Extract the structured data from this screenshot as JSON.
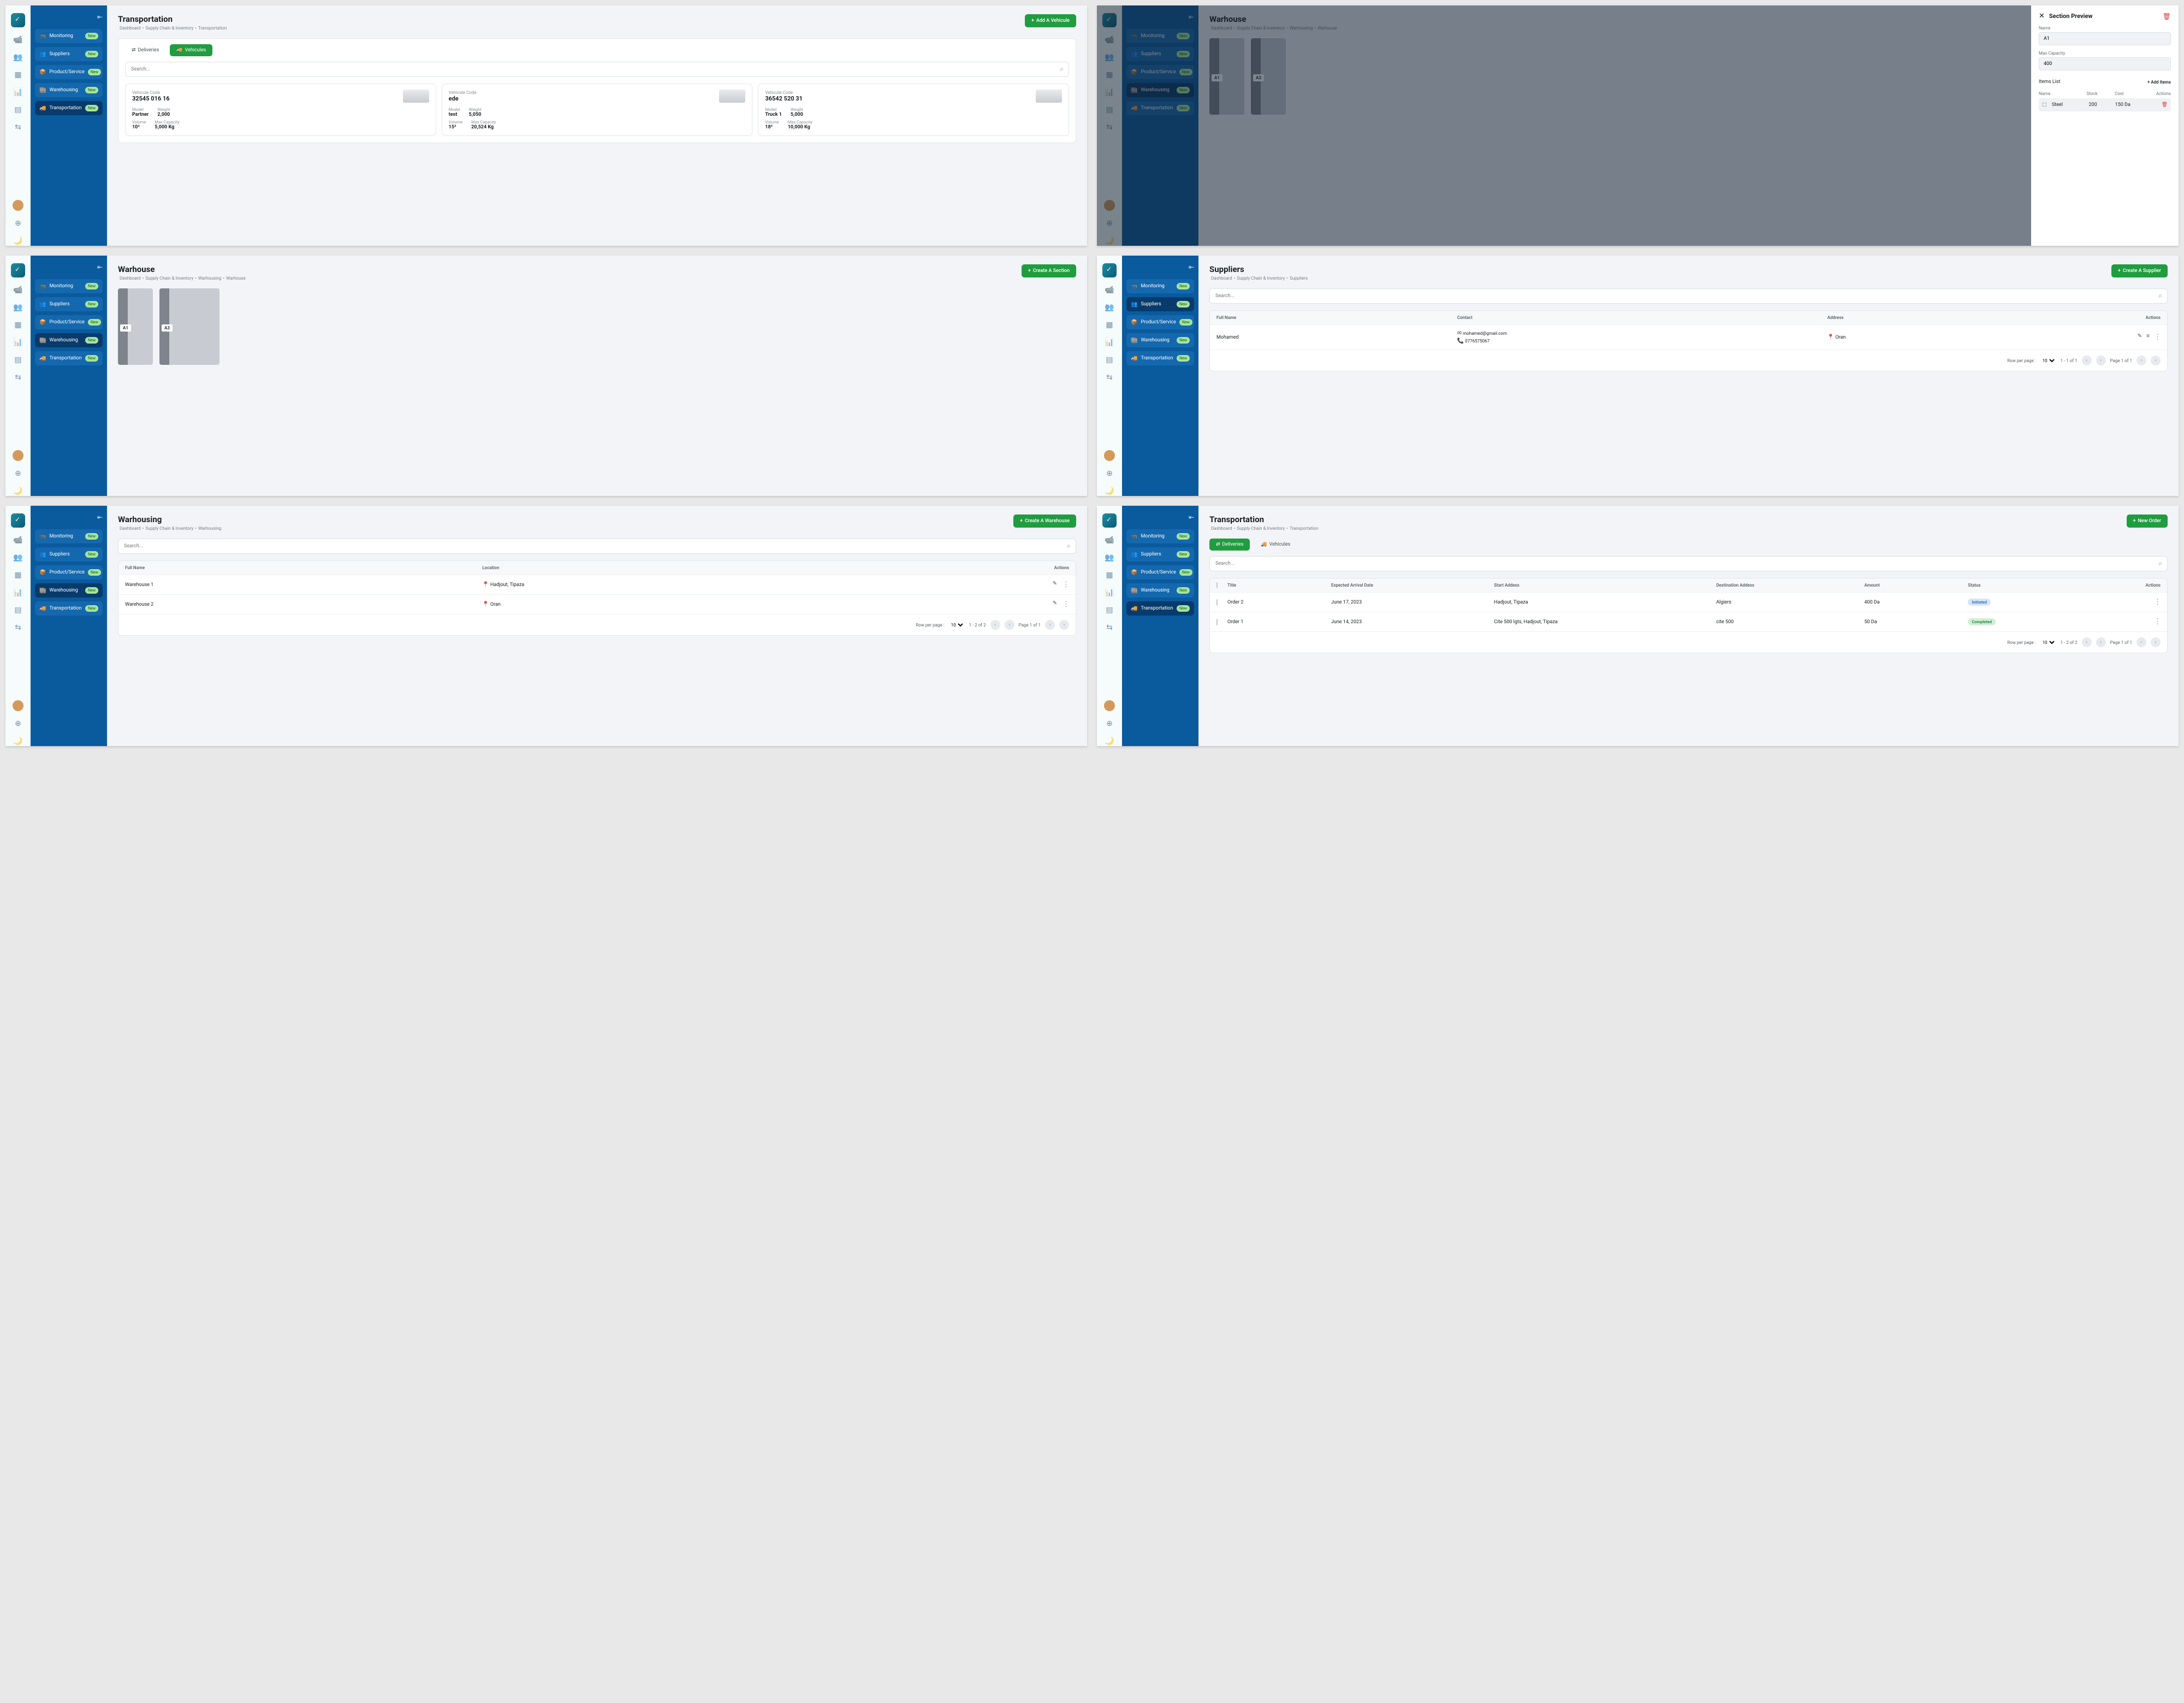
{
  "nav": {
    "items": [
      {
        "icon": "📹",
        "label": "Monitoring",
        "badge": "New"
      },
      {
        "icon": "👥",
        "label": "Suppliers",
        "badge": "New"
      },
      {
        "icon": "📦",
        "label": "Product/Service",
        "badge": "New"
      },
      {
        "icon": "🏬",
        "label": "Warehousing",
        "badge": "New"
      },
      {
        "icon": "🚚",
        "label": "Transportation",
        "badge": "New"
      }
    ]
  },
  "p1": {
    "title": "Transportation",
    "crumb": [
      "Dashboard",
      "Supply Chain & Inventory",
      "Transportation"
    ],
    "cta": "Add A Vehicule",
    "tabs": [
      {
        "icon": "⇄",
        "label": "Deliveries"
      },
      {
        "icon": "🚚",
        "label": "Vehicules"
      }
    ],
    "search_ph": "Search...",
    "labels": {
      "vc": "Vehicule Code",
      "model": "Model",
      "weight": "Weight",
      "vol": "Volume",
      "max": "Max Capacity"
    },
    "vehicles": [
      {
        "code": "32545 016 16",
        "model": "Partner",
        "weight": "2,000",
        "vol": "10³",
        "max": "5,000 Kg"
      },
      {
        "code": "ede",
        "model": "test",
        "weight": "5,050",
        "vol": "15³",
        "max": "20,524 Kg"
      },
      {
        "code": "36542 520 31",
        "model": "Truck 1",
        "weight": "5,000",
        "vol": "18³",
        "max": "10,000 Kg"
      }
    ]
  },
  "p2": {
    "title": "Warhouse",
    "crumb": [
      "Dashboard",
      "Supply Chain & Inventory",
      "Warhousing",
      "Warhouse"
    ],
    "sec": [
      "A1",
      "A3"
    ],
    "sheet": {
      "title": "Section Preview",
      "name_lbl": "Name",
      "name_val": "A1",
      "cap_lbl": "Max Capacity",
      "cap_val": "400",
      "items_lbl": "Items List",
      "add_lbl": "Add Items",
      "cols": {
        "name": "Name",
        "stock": "Stock",
        "cost": "Cost",
        "actions": "Actions"
      },
      "item": {
        "icon": "⬚",
        "name": "Steel",
        "stock": "200",
        "cost": "150 Da"
      }
    }
  },
  "p3": {
    "title": "Warhouse",
    "crumb": [
      "Dashboard",
      "Supply Chain & Inventory",
      "Warhousing",
      "Warhouse"
    ],
    "cta": "Create A Section",
    "sec": [
      "A1",
      "A3"
    ]
  },
  "p4": {
    "title": "Suppliers",
    "crumb": [
      "Dashboard",
      "Supply Chain & Inventory",
      "Suppliers"
    ],
    "cta": "Create A Supplier",
    "search_ph": "Search...",
    "cols": {
      "fn": "Full Name",
      "contact": "Contact",
      "addr": "Address",
      "actions": "Actions"
    },
    "row": {
      "name": "Mohamed",
      "email": "mohamed@gmail.com",
      "phone": "0776575067",
      "addr": "Oran"
    },
    "pgn": {
      "rpp": "Row per page :",
      "val": "10",
      "range": "1 - 1 of 1",
      "page": "Page 1 of 1"
    }
  },
  "p5": {
    "title": "Warhousing",
    "crumb": [
      "Dashboard",
      "Supply Chain & Inventory",
      "Warhousing"
    ],
    "cta": "Create A Warehouse",
    "search_ph": "Search...",
    "cols": {
      "fn": "Full Name",
      "loc": "Location",
      "actions": "Actions"
    },
    "rows": [
      {
        "name": "Warehouse 1",
        "loc": "Hadjout, Tipaza"
      },
      {
        "name": "Warehouse 2",
        "loc": "Oran"
      }
    ],
    "pgn": {
      "rpp": "Row per page :",
      "val": "10",
      "range": "1 - 2 of 2",
      "page": "Page 1 of 1"
    }
  },
  "p6": {
    "title": "Transportation",
    "crumb": [
      "Dashboard",
      "Supply Chain & Inventory",
      "Transportation"
    ],
    "cta": "New Order",
    "tabs": [
      {
        "icon": "⇄",
        "label": "Deliveries"
      },
      {
        "icon": "🚚",
        "label": "Vehicules"
      }
    ],
    "search_ph": "Search...",
    "cols": {
      "title": "Title",
      "ead": "Expected Arrival Date",
      "sa": "Start Addess",
      "da": "Destination Addess",
      "amt": "Amount",
      "status": "Status",
      "actions": "Actions"
    },
    "rows": [
      {
        "title": "Order 2",
        "ead": "June 17, 2023",
        "sa": "Hadjout, Tipaza",
        "da": "Algiers",
        "amt": "400 Da",
        "status": "Initiated",
        "cls": "init"
      },
      {
        "title": "Order 1",
        "ead": "June 14, 2023",
        "sa": "Cite 500 lgts, Hadjout, Tipaza",
        "da": "cite 500",
        "amt": "50 Da",
        "status": "Completed",
        "cls": "comp"
      }
    ],
    "pgn": {
      "rpp": "Row per page :",
      "val": "10",
      "range": "1 - 2 of 2",
      "page": "Page 1 of 1"
    }
  }
}
